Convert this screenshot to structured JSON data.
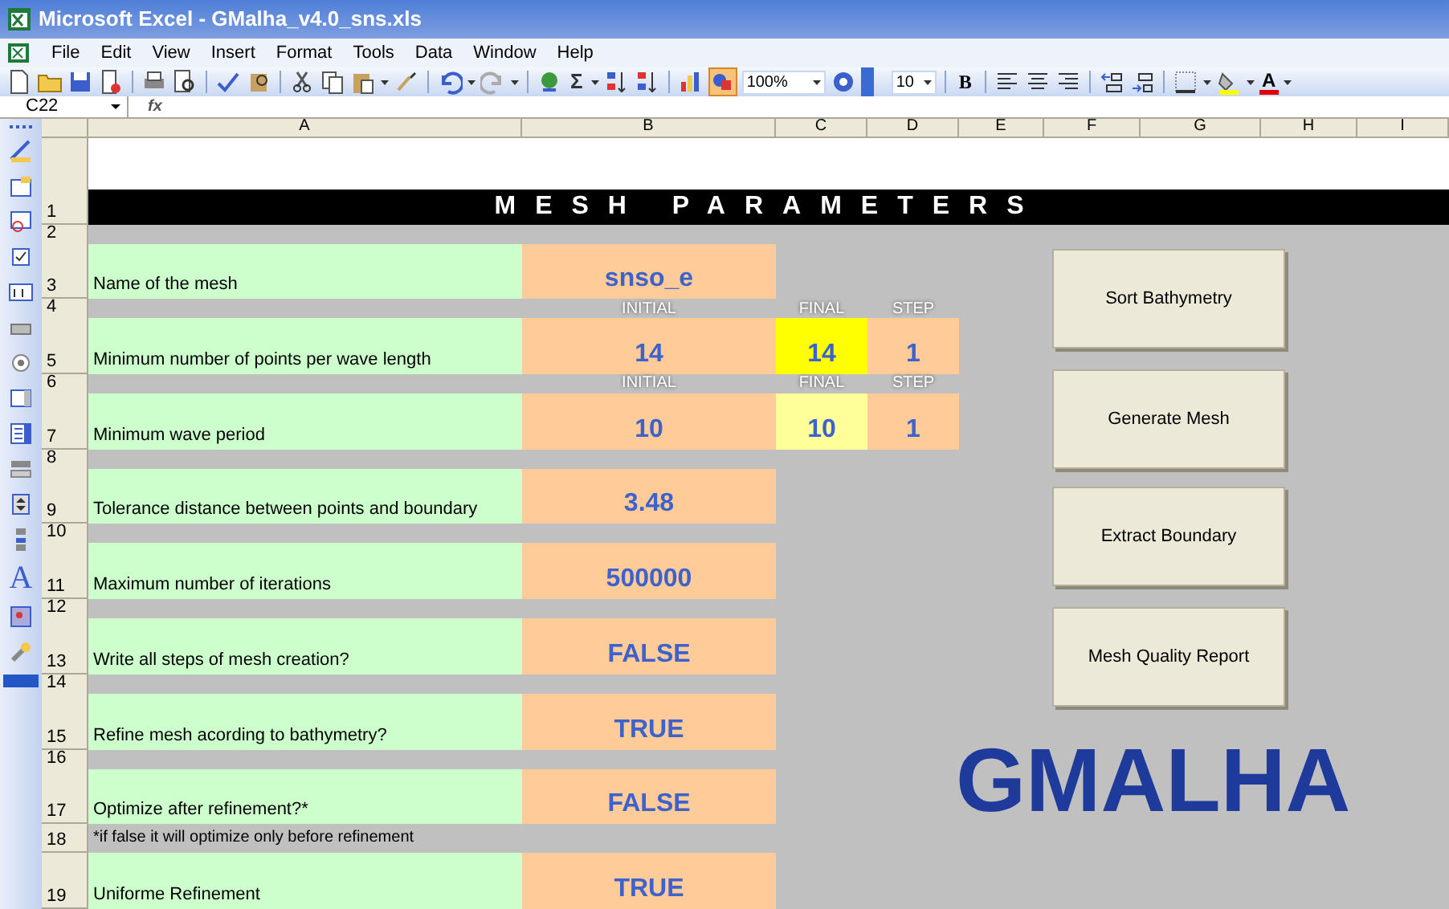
{
  "window": {
    "title": "Microsoft Excel - GMalha_v4.0_sns.xls"
  },
  "menu": [
    "File",
    "Edit",
    "View",
    "Insert",
    "Format",
    "Tools",
    "Data",
    "Window",
    "Help"
  ],
  "toolbar": {
    "sum": "Σ",
    "zoom": "100%",
    "font_size": "10",
    "bold": "B",
    "font_color": "A"
  },
  "formula_bar": {
    "name_box": "C22",
    "fx": "fx"
  },
  "forms_toolbar": {
    "label_tool": "A"
  },
  "columns": [
    "A",
    "B",
    "C",
    "D",
    "E",
    "F",
    "G",
    "H",
    "I"
  ],
  "rows": [
    {
      "number": "1",
      "kind": "title",
      "text": "MESH PARAMETERS"
    },
    {
      "number": "2",
      "kind": "spacer"
    },
    {
      "number": "3",
      "kind": "param",
      "label": "Name of the mesh",
      "value": "snso_e"
    },
    {
      "number": "4",
      "kind": "headers",
      "labels": [
        "INITIAL",
        "FINAL",
        "STEP"
      ]
    },
    {
      "number": "5",
      "kind": "range",
      "label": "Minimum number of points per wave length",
      "cells": [
        {
          "text": "14",
          "color": "#ffcc99"
        },
        {
          "text": "14",
          "color": "#ffff00"
        },
        {
          "text": "1",
          "color": "#ffcc99"
        }
      ]
    },
    {
      "number": "6",
      "kind": "headers",
      "labels": [
        "INITIAL",
        "FINAL",
        "STEP"
      ]
    },
    {
      "number": "7",
      "kind": "range",
      "label": "Minimum wave period",
      "cells": [
        {
          "text": "10",
          "color": "#ffcc99"
        },
        {
          "text": "10",
          "color": "#ffff99"
        },
        {
          "text": "1",
          "color": "#ffcc99"
        }
      ]
    },
    {
      "number": "8",
      "kind": "spacer"
    },
    {
      "number": "9",
      "kind": "param",
      "label": "Tolerance distance between points and boundary",
      "value": "3.48"
    },
    {
      "number": "10",
      "kind": "spacer"
    },
    {
      "number": "11",
      "kind": "param",
      "label": "Maximum number of iterations",
      "value": "500000"
    },
    {
      "number": "12",
      "kind": "spacer"
    },
    {
      "number": "13",
      "kind": "param",
      "label": "Write all steps of mesh creation?",
      "value": "FALSE"
    },
    {
      "number": "14",
      "kind": "spacer"
    },
    {
      "number": "15",
      "kind": "param",
      "label": "Refine mesh acording to bathymetry?",
      "value": "TRUE"
    },
    {
      "number": "16",
      "kind": "spacer"
    },
    {
      "number": "17",
      "kind": "param",
      "label": "Optimize after refinement?*",
      "value": "FALSE"
    },
    {
      "number": "18",
      "kind": "note",
      "text": "*if false it will optimize only before refinement"
    },
    {
      "number": "19",
      "kind": "param",
      "label": "Uniforme Refinement",
      "value": "TRUE"
    }
  ],
  "buttons": [
    "Sort Bathymetry",
    "Generate Mesh",
    "Extract Boundary",
    "Mesh Quality Report"
  ],
  "logo": "GMALHA"
}
